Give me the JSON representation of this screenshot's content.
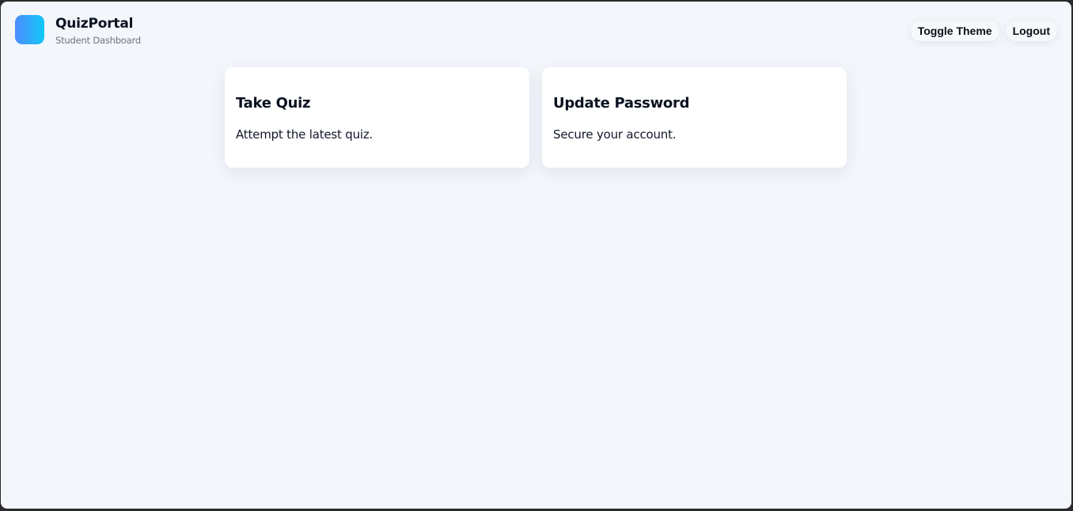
{
  "header": {
    "brand_title": "QuizPortal",
    "brand_subtitle": "Student Dashboard",
    "logo_gradient": [
      "#4f8cff",
      "#11c8f7"
    ],
    "toggle_theme_label": "Toggle Theme",
    "logout_label": "Logout"
  },
  "cards": [
    {
      "title": "Take Quiz",
      "description": "Attempt the latest quiz."
    },
    {
      "title": "Update Password",
      "description": "Secure your account."
    }
  ],
  "colors": {
    "page_background": "#f3f6fb",
    "card_background": "#ffffff",
    "text_primary": "#0b1220",
    "text_muted": "#6b7280"
  }
}
